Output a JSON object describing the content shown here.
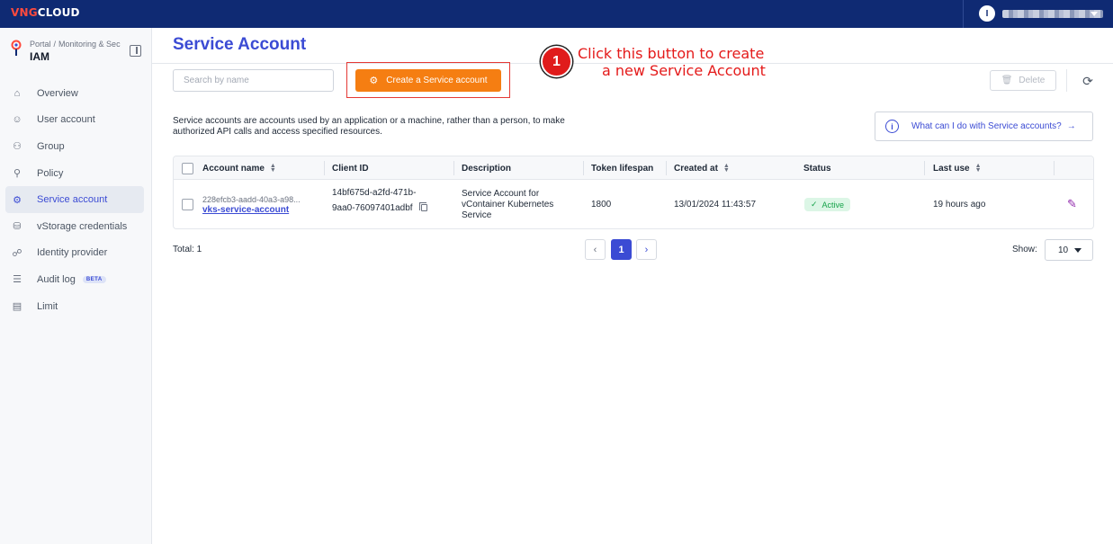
{
  "topbar": {
    "logo_prefix": "VNG",
    "logo_suffix": "CLOUD",
    "user_initial": "I"
  },
  "sidebar": {
    "breadcrumb": [
      "Portal",
      "Monitoring & Sec"
    ],
    "title": "IAM",
    "items": [
      {
        "label": "Overview",
        "icon": "home-icon",
        "glyph": "⌂"
      },
      {
        "label": "User account",
        "icon": "user-icon",
        "glyph": "☺"
      },
      {
        "label": "Group",
        "icon": "group-icon",
        "glyph": "⚇"
      },
      {
        "label": "Policy",
        "icon": "policy-icon",
        "glyph": "⚲"
      },
      {
        "label": "Service account",
        "icon": "service-account-icon",
        "glyph": "⚙"
      },
      {
        "label": "vStorage credentials",
        "icon": "storage-icon",
        "glyph": "⛁"
      },
      {
        "label": "Identity provider",
        "icon": "identity-provider-icon",
        "glyph": "☍"
      },
      {
        "label": "Audit log",
        "icon": "audit-log-icon",
        "glyph": "☰",
        "badge": "BETA"
      },
      {
        "label": "Limit",
        "icon": "limit-icon",
        "glyph": "▤"
      }
    ]
  },
  "page": {
    "title": "Service Account",
    "search_placeholder": "Search by name",
    "create_label": "Create a Service account",
    "delete_label": "Delete",
    "description": "Service accounts are accounts used by an application or a machine, rather than a person, to make authorized API calls and access specified resources.",
    "help_label": "What can I do with Service accounts?"
  },
  "annotation": {
    "step": "1",
    "line1": "Click this button to create",
    "line2": "a new Service Account"
  },
  "table": {
    "columns": [
      "Account name",
      "Client ID",
      "Description",
      "Token lifespan",
      "Created at",
      "Status",
      "Last use"
    ],
    "rows": [
      {
        "account_id": "228efcb3-aadd-40a3-a98...",
        "account_name": "vks-service-account",
        "client_id_1": "14bf675d-a2fd-471b-",
        "client_id_2": "9aa0-76097401adbf",
        "description_1": "Service Account for",
        "description_2": "vContainer Kubernetes",
        "description_3": "Service",
        "token_lifespan": "1800",
        "created_at": "13/01/2024 11:43:57",
        "status": "Active",
        "last_use": "19 hours ago"
      }
    ]
  },
  "footer": {
    "total": "Total: 1",
    "current_page": "1",
    "show_label": "Show:",
    "page_size": "10"
  },
  "colors": {
    "accent": "#3b4bd4",
    "primary_button": "#f57e12",
    "topbar": "#0f2a73",
    "annotation": "#e41a1a"
  }
}
